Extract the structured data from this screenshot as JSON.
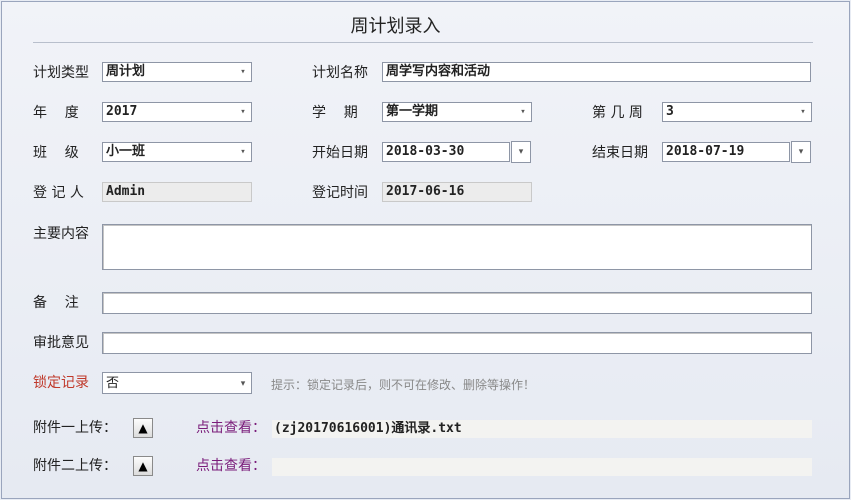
{
  "title": "周计划录入",
  "fields": {
    "plan_type": {
      "label": "计划类型",
      "value": "周计划"
    },
    "plan_name": {
      "label": "计划名称",
      "value": "周学写内容和活动"
    },
    "year": {
      "label": "年    度",
      "value": "2017"
    },
    "semester": {
      "label": "学    期",
      "value": "第一学期"
    },
    "week_no": {
      "label": "第 几 周",
      "value": "3"
    },
    "class": {
      "label": "班    级",
      "value": "小一班"
    },
    "start_date": {
      "label": "开始日期",
      "value": "2018-03-30"
    },
    "end_date": {
      "label": "结束日期",
      "value": "2018-07-19"
    },
    "registrant": {
      "label": "登 记 人",
      "value": "Admin"
    },
    "reg_time": {
      "label": "登记时间",
      "value": "2017-06-16"
    },
    "main_content": {
      "label": "主要内容",
      "value": ""
    },
    "remark": {
      "label": "备    注",
      "value": ""
    },
    "approval": {
      "label": "审批意见",
      "value": ""
    },
    "lock": {
      "label": "锁定记录",
      "value": "否",
      "hint": "提示：锁定记录后，则不可在修改、删除等操作！"
    }
  },
  "attachments": [
    {
      "label": "附件一上传：",
      "view_label": "点击查看：",
      "file": "(zj20170616001)通讯录.txt"
    },
    {
      "label": "附件二上传：",
      "view_label": "点击查看：",
      "file": ""
    }
  ],
  "icons": {
    "dropdown": "▾",
    "upload": "▲"
  },
  "colors": {
    "lock_label": "#c0392b",
    "view_link": "#7a1c7a"
  }
}
